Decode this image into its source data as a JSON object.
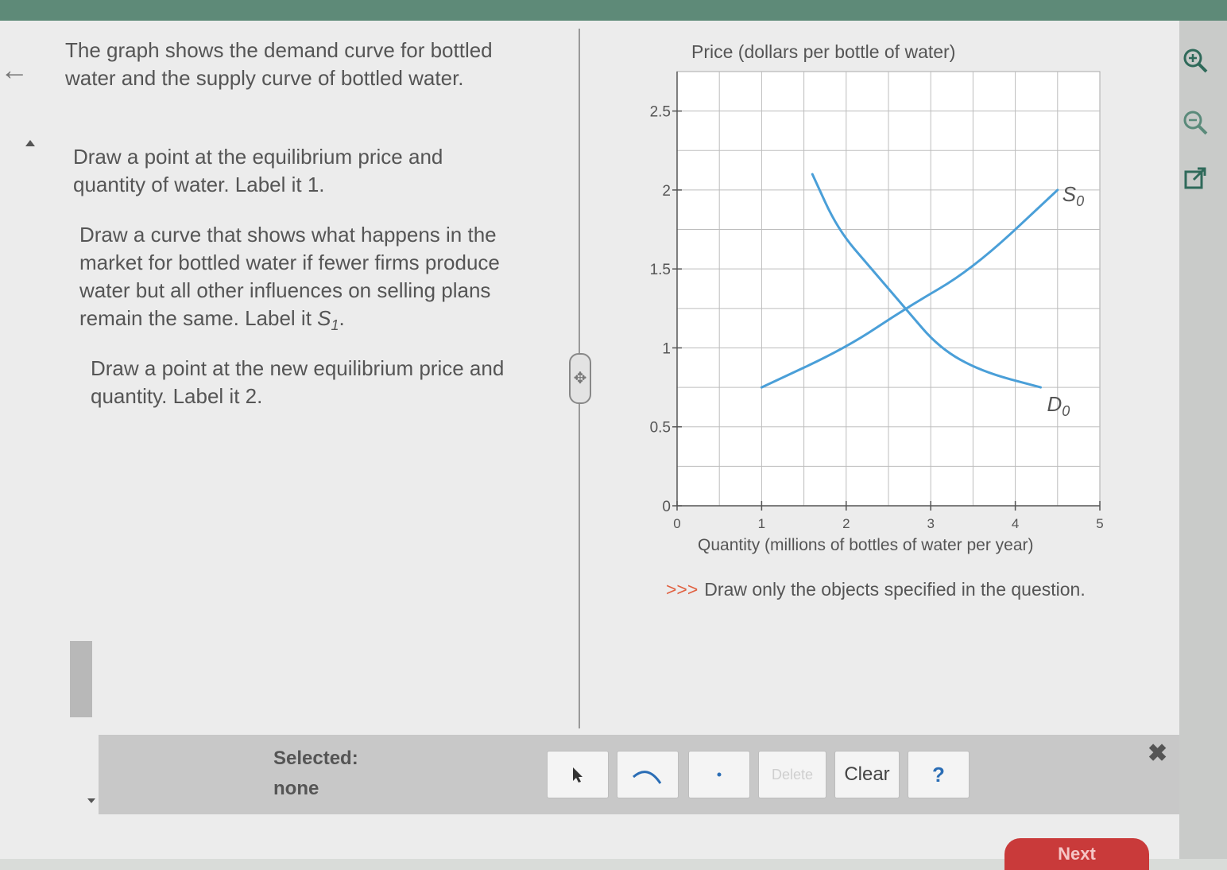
{
  "question": {
    "para1": "The graph shows the demand curve for bottled water and the supply curve of bottled water.",
    "para2": "Draw a point at the equilibrium price and quantity of water. Label it 1.",
    "para3": "Draw a curve that shows what happens in the market for bottled water if fewer firms produce water but all other influences on selling plans remain the same. Label it",
    "para3_label": "S",
    "para3_label_sub": "1",
    "para4": "Draw a point at the new equilibrium price and quantity. Label it 2."
  },
  "chart_data": {
    "type": "line",
    "ylabel": "Price (dollars per bottle of water)",
    "xlabel": "Quantity (millions of bottles of water per year)",
    "x_ticks": [
      "0",
      "1",
      "2",
      "3",
      "4",
      "5"
    ],
    "y_ticks": [
      "0",
      "0.5",
      "1",
      "1.5",
      "2",
      "2.5"
    ],
    "xlim": [
      0,
      5
    ],
    "ylim": [
      0,
      2.75
    ],
    "grid": true,
    "series": [
      {
        "name": "S",
        "name_sub": "0",
        "color": "#4a9fd8",
        "x": [
          1.0,
          2.0,
          2.7,
          3.5,
          4.5
        ],
        "y": [
          0.75,
          1.0,
          1.25,
          1.5,
          2.0
        ]
      },
      {
        "name": "D",
        "name_sub": "0",
        "color": "#4a9fd8",
        "x": [
          1.6,
          1.9,
          2.3,
          2.7,
          3.1,
          3.6,
          4.3
        ],
        "y": [
          2.1,
          1.75,
          1.5,
          1.25,
          1.0,
          0.85,
          0.75
        ]
      }
    ]
  },
  "instruction": {
    "chevrons": ">>>",
    "text": "Draw only the objects specified in the question."
  },
  "toolbar": {
    "selected_label": "Selected:",
    "selected_value": "none",
    "delete_label": "Delete",
    "clear_label": "Clear",
    "help_label": "?",
    "close_label": "✖"
  },
  "next_label": "Next"
}
